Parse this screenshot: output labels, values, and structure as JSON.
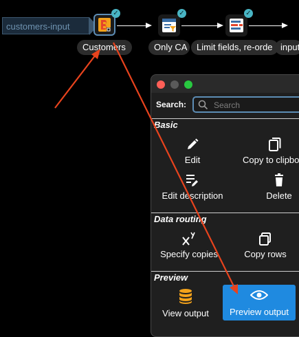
{
  "pipeline": {
    "input_tag": "customers-input",
    "nodes": [
      {
        "label": "Customers",
        "icon": "customers-source-icon"
      },
      {
        "label": "Only CA",
        "icon": "filter-icon"
      },
      {
        "label": "Limit fields, re-orde",
        "icon": "limit-fields-icon"
      },
      {
        "label": "input",
        "icon": "input-icon"
      }
    ]
  },
  "popup": {
    "search_label": "Search:",
    "search_placeholder": "Search",
    "sections": {
      "basic": "Basic",
      "data_routing": "Data routing",
      "preview": "Preview"
    },
    "actions": {
      "edit": "Edit",
      "copy_to_clipboard": "Copy to clipbo",
      "edit_description": "Edit description",
      "delete": "Delete",
      "specify_copies": "Specify copies",
      "copy_rows": "Copy rows",
      "view_output": "View output",
      "preview_output": "Preview output"
    }
  },
  "colors": {
    "background": "#000000",
    "accent": "#1f8ae0",
    "selection_border": "#5d8db5",
    "status_check": "#49b5c4",
    "annotation_arrow": "#e8431d",
    "close": "#ff5f57"
  }
}
